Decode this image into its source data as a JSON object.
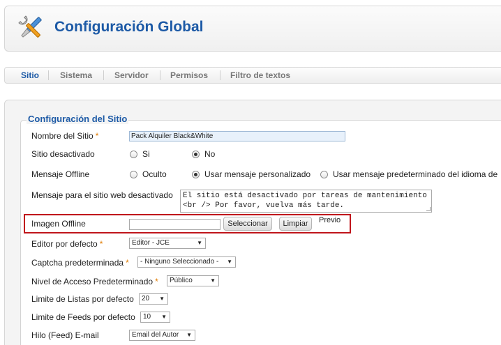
{
  "header": {
    "title": "Configuración Global",
    "icon": "tools-icon"
  },
  "tabs": [
    {
      "label": "Sitio",
      "active": true
    },
    {
      "label": "Sistema",
      "active": false
    },
    {
      "label": "Servidor",
      "active": false
    },
    {
      "label": "Permisos",
      "active": false
    },
    {
      "label": "Filtro de textos",
      "active": false
    }
  ],
  "section": {
    "legend": "Configuración del Sitio"
  },
  "required_marker": "*",
  "fields": {
    "site_name": {
      "label": "Nombre del Sitio",
      "value": "Pack Alquiler Black&White"
    },
    "offline": {
      "label": "Sitio desactivado",
      "options": [
        "Si",
        "No"
      ],
      "selected": "No"
    },
    "offline_message": {
      "label": "Mensaje Offline",
      "options": [
        "Oculto",
        "Usar mensaje personalizado",
        "Usar mensaje predeterminado del idioma de"
      ],
      "selected": "Usar mensaje personalizado"
    },
    "offline_text": {
      "label": "Mensaje para el sitio web desactivado",
      "value": "El sitio está desactivado por tareas de mantenimiento <br /> Por favor, vuelva más tarde."
    },
    "offline_image": {
      "label": "Imagen Offline",
      "value": "",
      "select_label": "Seleccionar",
      "clear_label": "Limpiar",
      "preview_label": "Previo"
    },
    "editor": {
      "label": "Editor por defecto",
      "value": "Editor - JCE"
    },
    "captcha": {
      "label": "Captcha predeterminada",
      "value": "- Ninguno Seleccionado -"
    },
    "access": {
      "label": "Nivel de Acceso Predeterminado",
      "value": "Público"
    },
    "list_limit": {
      "label": "Limite de Listas por defecto",
      "value": "20"
    },
    "feed_limit": {
      "label": "Limite de Feeds por defecto",
      "value": "10"
    },
    "feed_email": {
      "label": "Hilo (Feed) E-mail",
      "value": "Email del Autor"
    }
  },
  "colors": {
    "accent": "#1d5aa6",
    "required": "#e07b00",
    "highlight": "#c0151b"
  }
}
